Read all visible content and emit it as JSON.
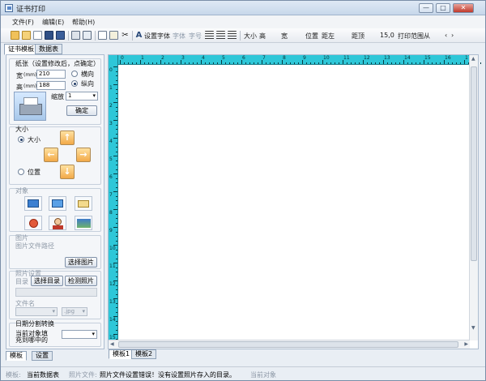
{
  "window": {
    "title": "证书打印",
    "min": "—",
    "max": "□",
    "close": "✕"
  },
  "menu": [
    "文件(F)",
    "编辑(E)",
    "帮助(H)"
  ],
  "toolbar": {
    "set_font": "设置字体",
    "font_family": "字体",
    "font_size": "字号",
    "size_label": "大小",
    "size_value": "高",
    "width_label": "宽",
    "position_label": "位置",
    "position_value": "距左",
    "top_label": "距顶",
    "top_value": "15,0",
    "print_range": "打印范围",
    "range_from": "从"
  },
  "tabs_top": [
    "证书模板",
    "数据表"
  ],
  "left": {
    "paper_group": "纸张（设置修改后，点确定）",
    "width_label": "宽",
    "width_unit": "(mm)",
    "width_value": "210",
    "height_label": "高",
    "height_unit": "(mm)",
    "height_value": "188",
    "landscape": "横向",
    "portrait": "纵向",
    "zoom_label": "缩放",
    "zoom_value": "1",
    "confirm": "确定",
    "size_group": "大小",
    "size_radio": "大小",
    "position_radio": "位置",
    "object_group": "对象",
    "image_group": "图片",
    "image_path_label": "图片文件路径",
    "select_image": "选择图片",
    "photo_group": "照片设置",
    "dir_label": "目录",
    "select_dir": "选择目录",
    "check_photo": "检测照片",
    "filename_label": "文件名",
    "file_ext": ".jpg",
    "date_group": "日期分割转换",
    "current_object": "当前对象填",
    "fill_into": "充到哪中的"
  },
  "bottom_tabs_left": [
    "模板",
    "设置"
  ],
  "bottom_tabs_right": [
    "模板1",
    "模板2"
  ],
  "ruler": {
    "top": [
      "0",
      "1",
      "2",
      "3",
      "4",
      "5",
      "6",
      "7",
      "8",
      "9",
      "10",
      "11",
      "12",
      "13",
      "14",
      "15",
      "16",
      "17"
    ],
    "left": [
      "0",
      "1",
      "2",
      "3",
      "4",
      "5",
      "6",
      "7",
      "8",
      "9",
      "10",
      "11",
      "12",
      "13",
      "14",
      "15"
    ]
  },
  "status": {
    "template_label": "模板:",
    "current_table": "当前数据表",
    "photo_file_label": "照片文件:",
    "photo_message": "照片文件设置错误！没有设置照片存入的目录。",
    "current_object": "当前对象"
  }
}
